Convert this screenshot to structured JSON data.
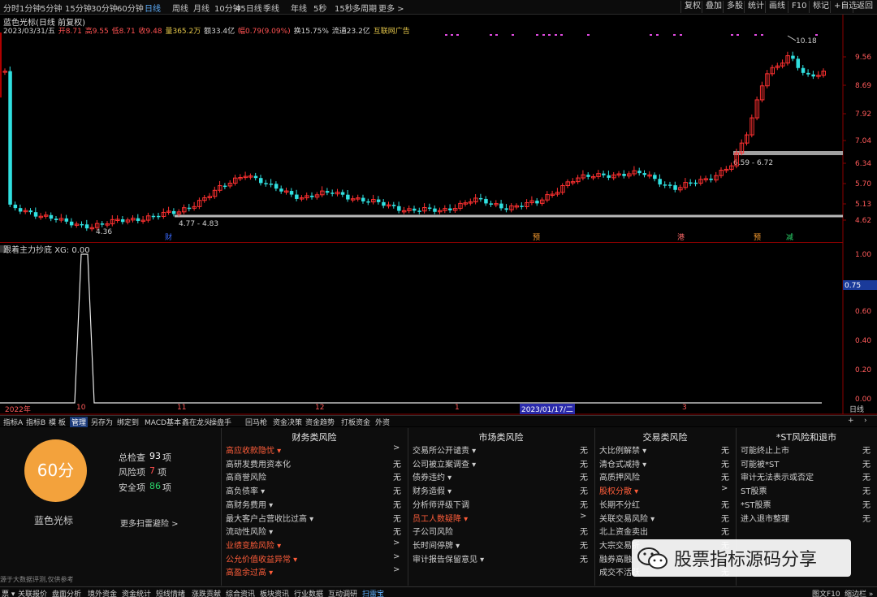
{
  "toolbar": {
    "periods": [
      "分时",
      "1分钟",
      "5分钟",
      "15分钟",
      "30分钟",
      "60分钟",
      "日线",
      "周线",
      "月线",
      "10分钟",
      "45日线",
      "季线",
      "年线",
      "5秒",
      "15秒",
      "多周期",
      "更多 >"
    ],
    "active": "日线",
    "right": [
      "复权",
      "叠加",
      "多股",
      "统计",
      "画线",
      "F10",
      "标记",
      "+自选",
      "返回"
    ]
  },
  "title": "蓝色光标(日线 前复权)",
  "info": {
    "date": "2023/03/31/五",
    "open": "开8.71",
    "high": "高9.55",
    "low": "低8.71",
    "close": "收9.48",
    "vol": "量365.2万",
    "amt": "额33.4亿",
    "chg": "幅0.79(9.09%)",
    "turn": "换15.75%",
    "float": "流通23.2亿",
    "concept": "互联网广告"
  },
  "price_axis": [
    "9.56",
    "8.69",
    "7.92",
    "7.04",
    "6.34",
    "5.70",
    "5.13",
    "4.62"
  ],
  "price_labels": {
    "high_mark": "10.18",
    "low_mark": "4.36",
    "band1": "4.77 - 4.83",
    "band2": "6.59 - 6.72"
  },
  "event_marks": [
    "财",
    "预",
    "港",
    "预",
    "减"
  ],
  "indicator": {
    "title": "跟着主力抄底",
    "value": "XG: 0.00",
    "axis": [
      "1.00",
      "0.75",
      "0.60",
      "0.40",
      "0.20",
      "0.00"
    ]
  },
  "xaxis": [
    "2022年",
    "10",
    "11",
    "12",
    "1",
    "2023/01/17/二",
    "3"
  ],
  "xaxis_right": "日线",
  "tabs": [
    "指标A",
    "指标B",
    "模 板",
    "管理",
    "另存为",
    "绑定到",
    "MACD基本",
    "鑫在龙头",
    "操盘手",
    "回马枪",
    "资金决策",
    "资金趋势",
    "打板资金",
    "外资"
  ],
  "selected_tab": "管理",
  "risk": {
    "score": "60分",
    "stock": "蓝色光标",
    "total_label": "总检查",
    "total": "93",
    "total_unit": "项",
    "risk_label": "风险项",
    "risk": "7",
    "risk_unit": "项",
    "safe_label": "安全项",
    "safe": "86",
    "safe_unit": "项",
    "more": "更多扫雷避险 >",
    "disclaimer": "源于大数据评测,仅供参考"
  },
  "columns": [
    {
      "title": "财务类风险",
      "rows": [
        [
          "高应收款隐忧 ▾",
          ">",
          true
        ],
        [
          "高研发费用资本化",
          "无",
          false
        ],
        [
          "高商誉风险",
          "无",
          false
        ],
        [
          "高负债率 ▾",
          "无",
          false
        ],
        [
          "高财务费用 ▾",
          "无",
          false
        ],
        [
          "最大客户占营收比过高 ▾",
          "无",
          false
        ],
        [
          "流动性风险 ▾",
          "无",
          false
        ],
        [
          "业绩变脸风险 ▾",
          ">",
          true
        ],
        [
          "公允价值收益异常 ▾",
          ">",
          true
        ],
        [
          "高盈余过高 ▾",
          ">",
          true
        ]
      ]
    },
    {
      "title": "市场类风险",
      "rows": [
        [
          "交易所公开谴责 ▾",
          "无",
          false
        ],
        [
          "公司被立案调查 ▾",
          "无",
          false
        ],
        [
          "债券违约 ▾",
          "无",
          false
        ],
        [
          "财务造假 ▾",
          "无",
          false
        ],
        [
          "分析师评级下调",
          "无",
          false
        ],
        [
          "员工人数疑降 ▾",
          ">",
          true
        ],
        [
          "子公司风险",
          "无",
          false
        ],
        [
          "长时间停牌 ▾",
          "无",
          false
        ],
        [
          "审计报告保留意见 ▾",
          "无",
          false
        ]
      ]
    },
    {
      "title": "交易类风险",
      "rows": [
        [
          "大比例解禁 ▾",
          "无",
          false
        ],
        [
          "清仓式减持 ▾",
          "无",
          false
        ],
        [
          "高质押风险",
          "无",
          false
        ],
        [
          "股权分散 ▾",
          ">",
          true
        ],
        [
          "长期不分红",
          "无",
          false
        ],
        [
          "关联交易风险 ▾",
          "无",
          false
        ],
        [
          "北上资金卖出",
          "无",
          false
        ],
        [
          "大宗交易折",
          "无",
          false
        ],
        [
          "融券高融",
          "无",
          false
        ],
        [
          "成交不活跃",
          "无",
          false
        ]
      ]
    },
    {
      "title": "*ST风险和退市",
      "rows": [
        [
          "可能终止上市",
          "无",
          false
        ],
        [
          "可能被*ST",
          "无",
          false
        ],
        [
          "审计无法表示或否定",
          "无",
          false
        ],
        [
          "ST股票",
          "无",
          false
        ],
        [
          "*ST股票",
          "无",
          false
        ],
        [
          "进入退市整理",
          "无",
          false
        ]
      ]
    }
  ],
  "statusbar": [
    "票 ▾",
    "关联报价",
    "盘面分析",
    "境外资金",
    "资金统计",
    "短线情绪",
    "涨跌贡献",
    "综合资讯",
    "板块资讯",
    "行业数据",
    "互动调研",
    "扫雷宝"
  ],
  "statusbar_right": [
    "图文F10",
    "缩边栏 »"
  ],
  "watermark": "股票指标源码分享",
  "colors": {
    "up": "#ff3030",
    "down": "#30e0e0",
    "accent": "#f3a23c"
  }
}
